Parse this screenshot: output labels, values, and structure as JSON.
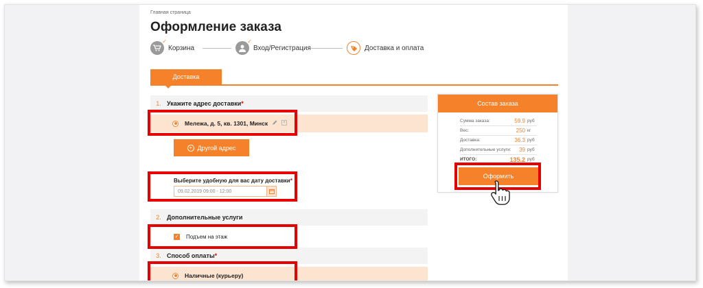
{
  "breadcrumb": "Главная страница",
  "page_title": "Оформление заказа",
  "steps": [
    {
      "label": "Корзина",
      "check": "✓"
    },
    {
      "label": "Вход/Регистрация",
      "check": "✓"
    },
    {
      "label": "Доставка и оплата",
      "check": ""
    }
  ],
  "tab": {
    "label": "Доставка"
  },
  "section1": {
    "num": "1.",
    "title": "Укажите адрес доставки",
    "required": "*"
  },
  "address_option": {
    "text": "Мележа, д. 5, кв. 1301, Минск"
  },
  "other_address_button": "Другой адрес",
  "date": {
    "label": "Выберите удобную для вас дату доставки",
    "required": "*",
    "value": "09.02.2019 09:00 - 12:00"
  },
  "section2": {
    "num": "2.",
    "title": "Дополнительные услуги"
  },
  "extra_service": {
    "label": "Подъем на этаж",
    "checked": true
  },
  "section3": {
    "num": "3.",
    "title": "Способ оплаты",
    "required": "*"
  },
  "payment_option": {
    "text": "Наличные (курьеру)"
  },
  "order_summary": {
    "title": "Состав заказа",
    "rows": [
      {
        "key": "Сумма заказа:",
        "value": "59.9",
        "unit": "руб"
      },
      {
        "key": "Вес:",
        "value": "250",
        "unit": "кг"
      },
      {
        "key": "Доставка:",
        "value": "36.3",
        "unit": "руб"
      },
      {
        "key": "Дополнительные услуги:",
        "value": "39",
        "unit": "руб"
      },
      {
        "key": "ИТОГО:",
        "value": "135.2",
        "unit": "руб"
      }
    ],
    "submit_label": "Оформить"
  },
  "colors": {
    "accent": "#f5822a",
    "highlight": "#e60000",
    "selected_row": "#fde4d0"
  },
  "icons": {
    "cart": "cart-icon",
    "user": "user-icon",
    "delivery": "delivery-icon",
    "edit": "pencil-icon",
    "cursor": "hand-cursor-icon"
  }
}
